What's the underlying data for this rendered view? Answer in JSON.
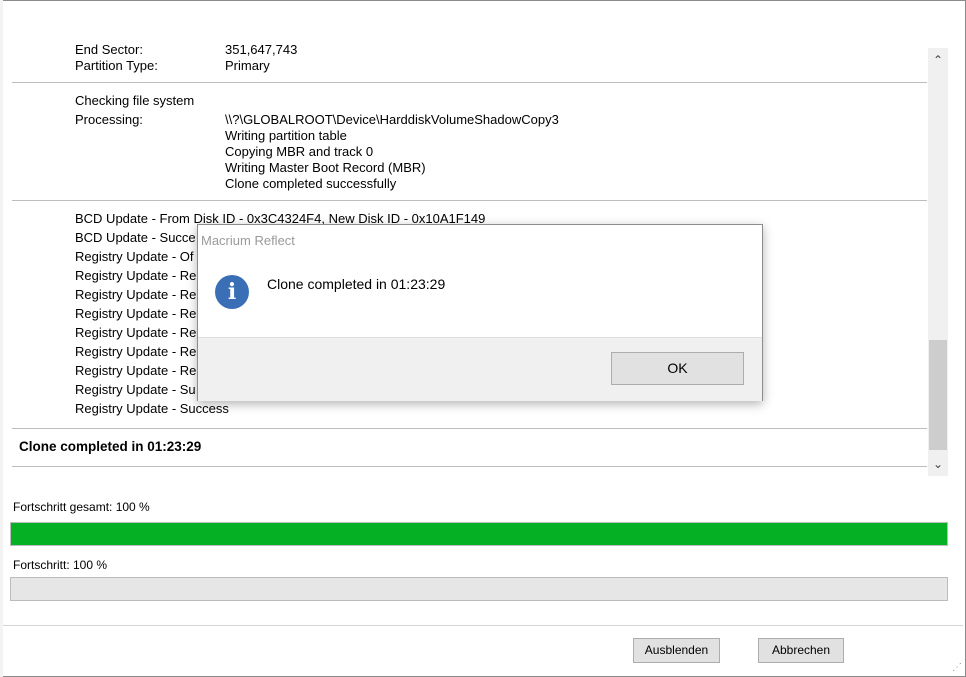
{
  "log": {
    "partition": {
      "end_sector_label": "End Sector:",
      "end_sector_value": "351,647,743",
      "type_label": "Partition Type:",
      "type_value": "Primary"
    },
    "filesystem": {
      "checking": "Checking file system",
      "processing_label": "Processing:",
      "processing_lines": [
        "\\\\?\\GLOBALROOT\\Device\\HarddiskVolumeShadowCopy3",
        "Writing partition table",
        "Copying MBR and track 0",
        "Writing Master Boot Record (MBR)",
        "Clone completed successfully"
      ]
    },
    "bcd": [
      "BCD Update - From Disk ID - 0x3C4324F4,  New Disk ID - 0x10A1F149",
      "BCD Update - Succe",
      "Registry Update - Of",
      "Registry Update - Re",
      "Registry Update - Re",
      "Registry Update - Re",
      "Registry Update - Re",
      "Registry Update - Re",
      "Registry Update - Re",
      "Registry Update - Su",
      "Registry Update - Success"
    ],
    "summary": "Clone completed in 01:23:29"
  },
  "progress": {
    "total_label": "Fortschritt gesamt:  100 %",
    "total_value": 1.0,
    "current_label": "Fortschritt:  100 %",
    "current_value": 0,
    "fill_color": "#06b025"
  },
  "buttons": {
    "hide": "Ausblenden",
    "cancel": "Abbrechen"
  },
  "dialog": {
    "title": "Macrium Reflect",
    "icon": "info-icon",
    "message": "Clone completed in 01:23:29",
    "ok": "OK"
  },
  "scrollbar": {
    "up": "⌃",
    "down": "⌄"
  }
}
